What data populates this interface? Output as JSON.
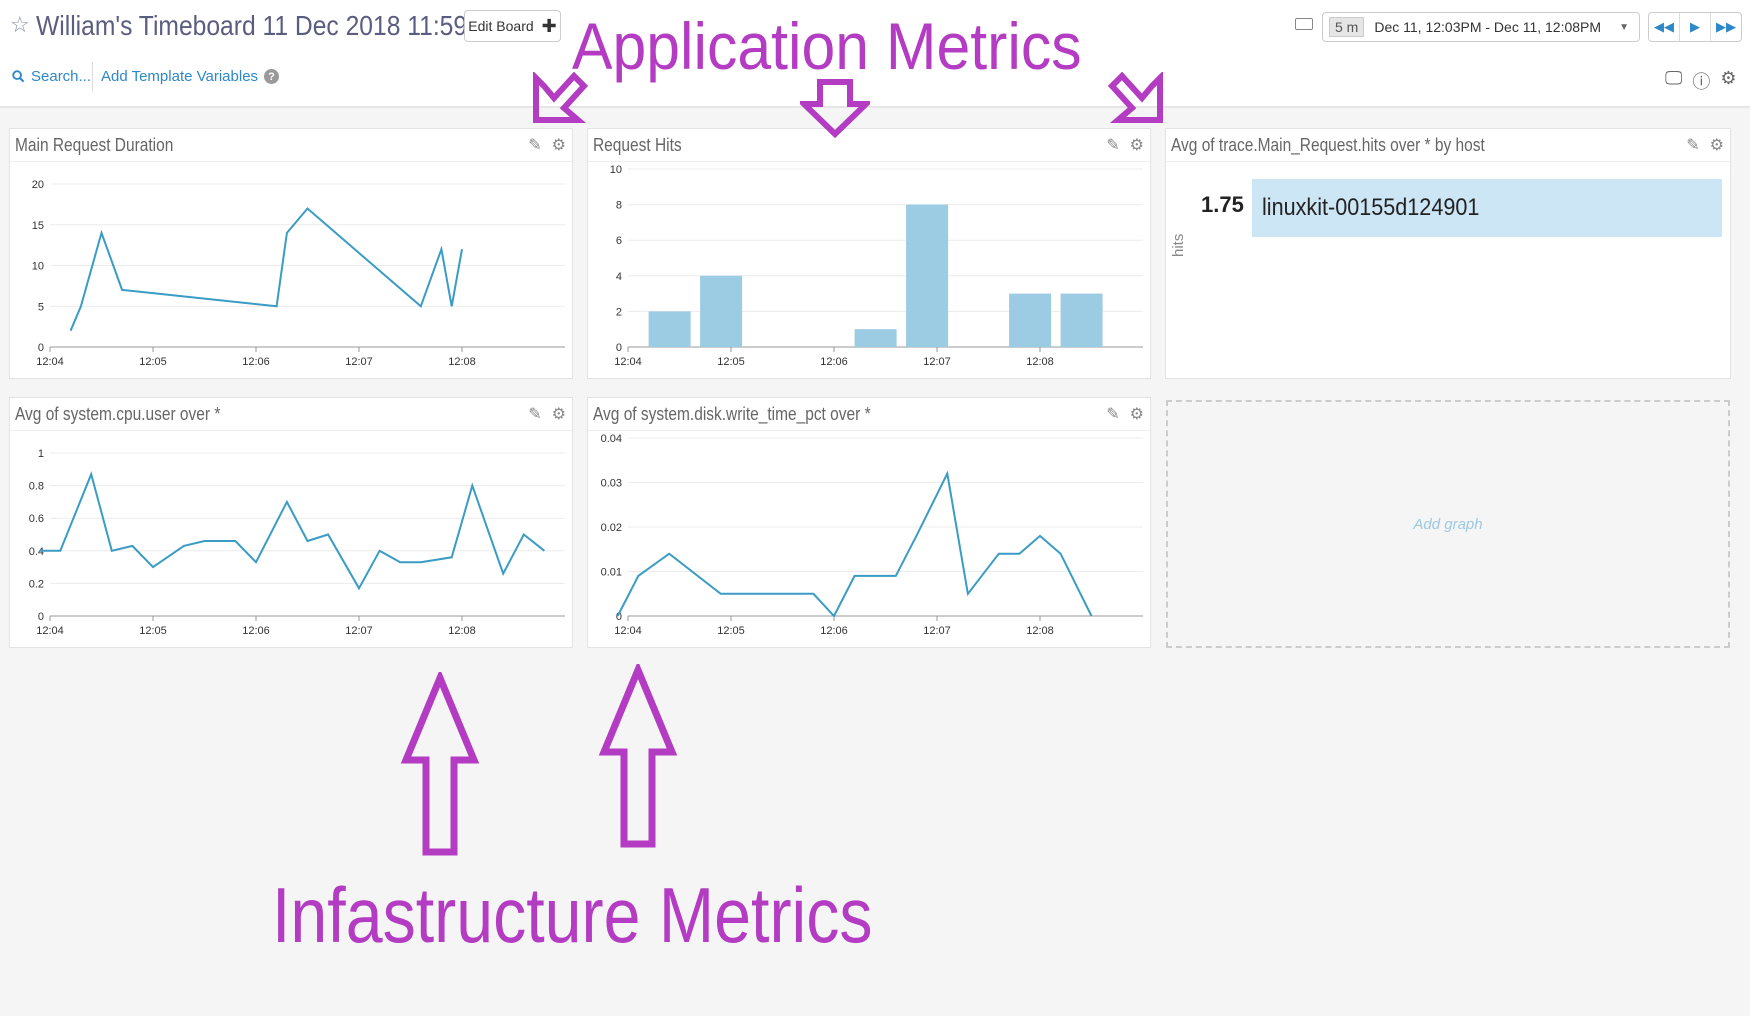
{
  "header": {
    "title": "William's Timeboard 11 Dec 2018 11:59",
    "edit_board_label": "Edit Board",
    "search_label": "Search...",
    "template_variables_label": "Add Template Variables",
    "timespan": "5 m",
    "time_range": "Dec 11, 12:03PM - Dec 11, 12:08PM"
  },
  "icons": [
    "star-icon",
    "plus-icon",
    "search-icon",
    "help-icon",
    "keyboard-icon",
    "rewind-icon",
    "play-icon",
    "fast-forward-icon",
    "monitor-icon",
    "info-icon",
    "gear-icon",
    "pencil-icon"
  ],
  "colors": {
    "accent": "#2e87c8",
    "series": "#3a9cc4",
    "bar": "#9ccbe4",
    "annotation": "#b33cc2"
  },
  "widgets": {
    "w1": {
      "title": "Main Request Duration"
    },
    "w2": {
      "title": "Request Hits"
    },
    "w3": {
      "title": "Avg of trace.Main_Request.hits over * by host",
      "value": "1.75",
      "host": "linuxkit-00155d124901",
      "axis_label": "hits"
    },
    "w4": {
      "title": "Avg of system.cpu.user over *"
    },
    "w5": {
      "title": "Avg of system.disk.write_time_pct over *"
    },
    "add_graph_label": "Add graph"
  },
  "annotations": {
    "application": "Application Metrics",
    "infrastructure": "Infastructure Metrics"
  },
  "chart_data": [
    {
      "id": "w1",
      "type": "line",
      "title": "Main Request Duration",
      "x_ticks": [
        "12:04",
        "12:05",
        "12:06",
        "12:07",
        "12:08"
      ],
      "y_ticks": [
        "0",
        "5",
        "10",
        "15",
        "20"
      ],
      "ylim": [
        0,
        20
      ],
      "xlim": [
        12.04,
        12.09
      ],
      "series": [
        {
          "x": [
            12.042,
            12.043,
            12.045,
            12.047,
            12.062,
            12.063,
            12.065,
            12.076,
            12.078,
            12.079,
            12.08
          ],
          "values": [
            2,
            5,
            14,
            7,
            5,
            14,
            17,
            5,
            12,
            5,
            12
          ]
        }
      ]
    },
    {
      "id": "w2",
      "type": "bar",
      "title": "Request Hits",
      "x_ticks": [
        "12:04",
        "12:05",
        "12:06",
        "12:07",
        "12:08"
      ],
      "y_ticks": [
        "0",
        "2",
        "4",
        "6",
        "8",
        "10"
      ],
      "ylim": [
        0,
        10
      ],
      "xlim": [
        12.04,
        12.09
      ],
      "bars": [
        {
          "x": 12.042,
          "value": 2
        },
        {
          "x": 12.047,
          "value": 4
        },
        {
          "x": 12.062,
          "value": 1
        },
        {
          "x": 12.067,
          "value": 8
        },
        {
          "x": 12.077,
          "value": 3
        },
        {
          "x": 12.082,
          "value": 3
        }
      ]
    },
    {
      "id": "w4",
      "type": "line",
      "title": "Avg of system.cpu.user over *",
      "x_ticks": [
        "12:04",
        "12:05",
        "12:06",
        "12:07",
        "12:08"
      ],
      "y_ticks": [
        "0",
        "0.2",
        "0.4",
        "0.6",
        "0.8",
        "1"
      ],
      "ylim": [
        0,
        1
      ],
      "xlim": [
        12.04,
        12.09
      ],
      "series": [
        {
          "x": [
            12.039,
            12.041,
            12.044,
            12.046,
            12.048,
            12.05,
            12.053,
            12.055,
            12.058,
            12.06,
            12.063,
            12.065,
            12.067,
            12.07,
            12.072,
            12.074,
            12.076,
            12.079,
            12.081,
            12.084,
            12.086,
            12.088
          ],
          "values": [
            0.4,
            0.4,
            0.87,
            0.4,
            0.43,
            0.3,
            0.43,
            0.46,
            0.46,
            0.33,
            0.7,
            0.46,
            0.5,
            0.17,
            0.4,
            0.33,
            0.33,
            0.36,
            0.8,
            0.26,
            0.5,
            0.4
          ]
        }
      ]
    },
    {
      "id": "w5",
      "type": "line",
      "title": "Avg of system.disk.write_time_pct over *",
      "x_ticks": [
        "12:04",
        "12:05",
        "12:06",
        "12:07",
        "12:08"
      ],
      "y_ticks": [
        "0",
        "0.01",
        "0.02",
        "0.03",
        "0.04"
      ],
      "ylim": [
        0,
        0.04
      ],
      "xlim": [
        12.04,
        12.09
      ],
      "series": [
        {
          "x": [
            12.039,
            12.041,
            12.044,
            12.049,
            12.054,
            12.058,
            12.06,
            12.062,
            12.066,
            12.068,
            12.071,
            12.073,
            12.076,
            12.078,
            12.08,
            12.082,
            12.085
          ],
          "values": [
            0,
            0.009,
            0.014,
            0.005,
            0.005,
            0.005,
            0,
            0.009,
            0.009,
            0.018,
            0.032,
            0.005,
            0.014,
            0.014,
            0.018,
            0.014,
            0
          ]
        }
      ]
    }
  ]
}
